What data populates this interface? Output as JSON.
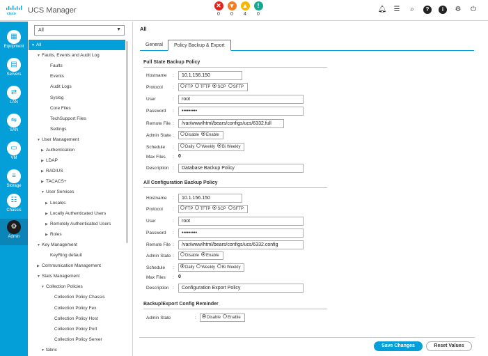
{
  "header": {
    "app_title": "UCS Manager",
    "faults": [
      {
        "icon": "critical-icon",
        "count": "0",
        "color": "#e2231a"
      },
      {
        "icon": "major-icon",
        "count": "0",
        "color": "#f47c20"
      },
      {
        "icon": "minor-icon",
        "count": "4",
        "color": "#f5b800"
      },
      {
        "icon": "warning-icon",
        "count": "0",
        "color": "#14a792"
      }
    ],
    "icons": [
      "bell-icon",
      "list-icon",
      "search-icon",
      "help-icon",
      "info-icon",
      "gear-icon",
      "logout-icon"
    ]
  },
  "leftnav": {
    "items": [
      {
        "label": "Equipment",
        "icon": "equipment-icon"
      },
      {
        "label": "Servers",
        "icon": "servers-icon"
      },
      {
        "label": "LAN",
        "icon": "lan-icon"
      },
      {
        "label": "SAN",
        "icon": "san-icon"
      },
      {
        "label": "VM",
        "icon": "vm-icon"
      },
      {
        "label": "Storage",
        "icon": "storage-icon"
      },
      {
        "label": "Chassis",
        "icon": "chassis-icon"
      },
      {
        "label": "Admin",
        "icon": "admin-icon"
      }
    ]
  },
  "tree": {
    "filter_value": "All",
    "items": [
      {
        "label": "All",
        "arrow": "▼"
      },
      {
        "label": "Faults, Events and Audit Log",
        "arrow": "▼"
      },
      {
        "label": "Faults",
        "arrow": ""
      },
      {
        "label": "Events",
        "arrow": ""
      },
      {
        "label": "Audit Logs",
        "arrow": ""
      },
      {
        "label": "Syslog",
        "arrow": ""
      },
      {
        "label": "Core Files",
        "arrow": ""
      },
      {
        "label": "TechSupport Files",
        "arrow": ""
      },
      {
        "label": "Settings",
        "arrow": ""
      },
      {
        "label": "User Management",
        "arrow": "▼"
      },
      {
        "label": "Authentication",
        "arrow": "▶"
      },
      {
        "label": "LDAP",
        "arrow": "▶"
      },
      {
        "label": "RADIUS",
        "arrow": "▶"
      },
      {
        "label": "TACACS+",
        "arrow": "▶"
      },
      {
        "label": "User Services",
        "arrow": "▼"
      },
      {
        "label": "Locales",
        "arrow": "▶"
      },
      {
        "label": "Locally Authenticated Users",
        "arrow": "▶"
      },
      {
        "label": "Remotely Authenticated Users",
        "arrow": "▶"
      },
      {
        "label": "Roles",
        "arrow": "▶"
      },
      {
        "label": "Key Management",
        "arrow": "▼"
      },
      {
        "label": "KeyRing default",
        "arrow": ""
      },
      {
        "label": "Communication Management",
        "arrow": "▶"
      },
      {
        "label": "Stats Management",
        "arrow": "▼"
      },
      {
        "label": "Collection Policies",
        "arrow": "▼"
      },
      {
        "label": "Collection Policy Chassis",
        "arrow": ""
      },
      {
        "label": "Collection Policy Fex",
        "arrow": ""
      },
      {
        "label": "Collection Policy Host",
        "arrow": ""
      },
      {
        "label": "Collection Policy Port",
        "arrow": ""
      },
      {
        "label": "Collection Policy Server",
        "arrow": ""
      },
      {
        "label": "fabric",
        "arrow": "▼"
      }
    ]
  },
  "main": {
    "breadcrumb": "All",
    "tabs": [
      {
        "label": "General"
      },
      {
        "label": "Policy Backup & Export"
      }
    ],
    "full_state": {
      "title": "Full State Backup Policy",
      "hostname_label": "Hostname",
      "hostname": "10.1.156.150",
      "protocol_label": "Protocol",
      "protocols": [
        "FTP",
        "TFTP",
        "SCP",
        "SFTP"
      ],
      "protocol_selected": "SCP",
      "user_label": "User",
      "user": "root",
      "password_label": "Password",
      "password": "•••••••••",
      "remote_file_label": "Remote File",
      "remote_file": "/var/www/html/bears/configs/ucs/6332.full",
      "admin_state_label": "Admin State",
      "admin_states": [
        "Disable",
        "Enable"
      ],
      "admin_state_selected": "Enable",
      "schedule_label": "Schedule",
      "schedules": [
        "Daily",
        "Weekly",
        "Bi Weekly"
      ],
      "schedule_selected": "Bi Weekly",
      "max_files_label": "Max Files",
      "max_files": "0",
      "description_label": "Description",
      "description": "Database Backup Policy"
    },
    "all_config": {
      "title": "All Configuration Backup Policy",
      "hostname_label": "Hostname",
      "hostname": "10.1.156.150",
      "protocol_label": "Protocol",
      "protocols": [
        "FTP",
        "TFTP",
        "SCP",
        "SFTP"
      ],
      "protocol_selected": "SCP",
      "user_label": "User",
      "user": "root",
      "password_label": "Password",
      "password": "•••••••••",
      "remote_file_label": "Remote File",
      "remote_file": "/var/www/html/bears/configs/ucs/6332.config",
      "admin_state_label": "Admin State",
      "admin_states": [
        "Disable",
        "Enable"
      ],
      "admin_state_selected": "Enable",
      "schedule_label": "Schedule",
      "schedules": [
        "Daily",
        "Weekly",
        "Bi Weekly"
      ],
      "schedule_selected": "Daily",
      "max_files_label": "Max Files",
      "max_files": "0",
      "description_label": "Description",
      "description": "Configuration Export Policy"
    },
    "reminder": {
      "title": "Backup/Export Config Reminder",
      "admin_state_label": "Admin State",
      "admin_states": [
        "Disable",
        "Enable"
      ],
      "admin_state_selected": "Disable"
    },
    "save_label": "Save Changes",
    "reset_label": "Reset Values"
  }
}
